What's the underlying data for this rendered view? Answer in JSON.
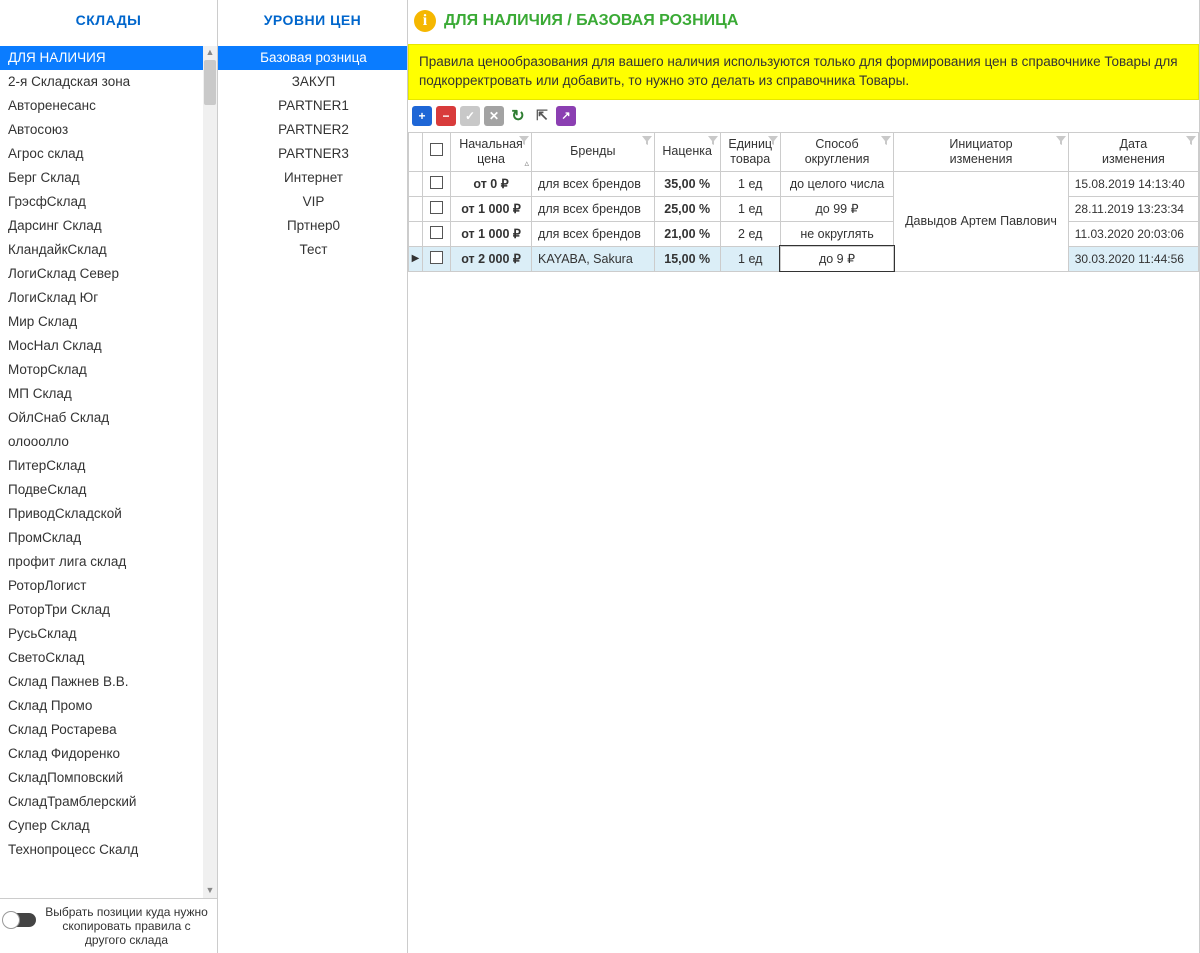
{
  "headers": {
    "warehouses": "СКЛАДЫ",
    "levels": "УРОВНИ ЦЕН",
    "main": "ДЛЯ НАЛИЧИЯ / БАЗОВАЯ РОЗНИЦА"
  },
  "warehouses": {
    "items": [
      "ДЛЯ НАЛИЧИЯ",
      "2-я Складская зона",
      "Авторенесанс",
      "Автосоюз",
      "Агрос склад",
      "Берг Склад",
      "ГрэсфСклад",
      "Дарсинг Склад",
      "КландайкСклад",
      "ЛогиСклад Север",
      "ЛогиСклад Юг",
      "Мир Склад",
      "МосНал Склад",
      "МоторСклад",
      "МП Склад",
      "ОйлСнаб Склад",
      "олооолло",
      "ПитерСклад",
      "ПодвеСклад",
      "ПриводСкладской",
      "ПромСклад",
      "профит лига склад",
      "РоторЛогист",
      "РоторТри Склад",
      "РусьСклад",
      "СветоСклад",
      "Склад Пажнев В.В.",
      "Склад Промо",
      "Склад Ростарева",
      "Склад Фидоренко",
      "СкладПомповский",
      "СкладТрамблерский",
      "Супер Склад",
      "Технопроцесс Скалд"
    ],
    "selected_index": 0
  },
  "levels": {
    "items": [
      "Базовая розница",
      "ЗАКУП",
      "PARTNER1",
      "PARTNER2",
      "PARTNER3",
      "Интернет",
      "VIP",
      "Пртнер0",
      "Тест"
    ],
    "selected_index": 0
  },
  "bottom_hint": "Выбрать позиции куда нужно скопировать правила с другого склада",
  "banner": "Правила ценообразования  для вашего наличия используются только для  формирования цен в справочнике Товары для подкорректровать или добавить, то  нужно это делать из справочника Товары.",
  "grid": {
    "columns": [
      "",
      "Начальная цена",
      "Бренды",
      "Наценка",
      "Единиц товара",
      "Способ округления",
      "Инициатор изменения",
      "Дата изменения"
    ],
    "initiator": "Давыдов Артем Павлович",
    "rows": [
      {
        "price": "от 0 ₽",
        "brands": "для всех брендов",
        "markup": "35,00 %",
        "units": "1 ед",
        "rounding": "до целого числа",
        "date": "15.08.2019 14:13:40"
      },
      {
        "price": "от 1 000 ₽",
        "brands": "для всех брендов",
        "markup": "25,00 %",
        "units": "1 ед",
        "rounding": "до 99 ₽",
        "date": "28.11.2019 13:23:34"
      },
      {
        "price": "от 1 000 ₽",
        "brands": "для всех брендов",
        "markup": "21,00 %",
        "units": "2 ед",
        "rounding": "не округлять",
        "date": "11.03.2020 20:03:06"
      },
      {
        "price": "от 2 000 ₽",
        "brands": "KAYABA, Sakura",
        "markup": "15,00 %",
        "units": "1 ед",
        "rounding": "до 9 ₽",
        "date": "30.03.2020 11:44:56",
        "selected": true
      }
    ]
  }
}
